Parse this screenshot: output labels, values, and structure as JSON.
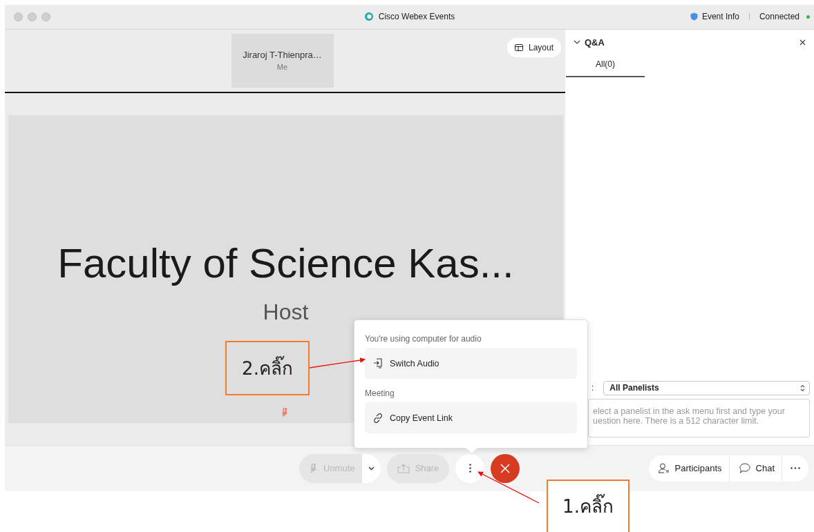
{
  "window": {
    "title": "Cisco Webex Events",
    "event_info": "Event Info",
    "connection": "Connected",
    "connected": true
  },
  "stage": {
    "thumbnail": {
      "name": "Jiraroj T-Thienpra…",
      "label": "Me"
    },
    "layout_button": "Layout",
    "slide": {
      "title": "Faculty of Science Kas...",
      "subtitle": "Host",
      "muted": true
    }
  },
  "qa": {
    "title": "Q&A",
    "expanded": true,
    "tabs": [
      {
        "label": "All(0)",
        "selected": true
      }
    ],
    "ask_label": ":",
    "ask_select": "All Panelists",
    "question": {
      "placeholder": "elect a panelist in the ask menu first and type your uestion here. There is a 512 character limit."
    }
  },
  "menu": {
    "sections": [
      {
        "heading": "You're using computer for audio",
        "items": [
          {
            "label": "Switch Audio",
            "kind": "switch"
          }
        ]
      },
      {
        "heading": "Meeting",
        "items": [
          {
            "label": "Copy Event Link",
            "kind": "link"
          }
        ]
      }
    ]
  },
  "controls": [
    {
      "kind": "unmute",
      "label": "Unmute",
      "disabled": true
    },
    {
      "kind": "share",
      "label": "Share",
      "disabled": true
    },
    {
      "kind": "more",
      "selected": true
    },
    {
      "kind": "end"
    }
  ],
  "side_buttons": [
    {
      "kind": "participants",
      "label": "Participants"
    },
    {
      "kind": "chat",
      "label": "Chat"
    },
    {
      "kind": "more"
    }
  ],
  "annotations": [
    {
      "label": "2.คลิ๊ก"
    },
    {
      "label": "1.คลิ๊ก"
    }
  ]
}
